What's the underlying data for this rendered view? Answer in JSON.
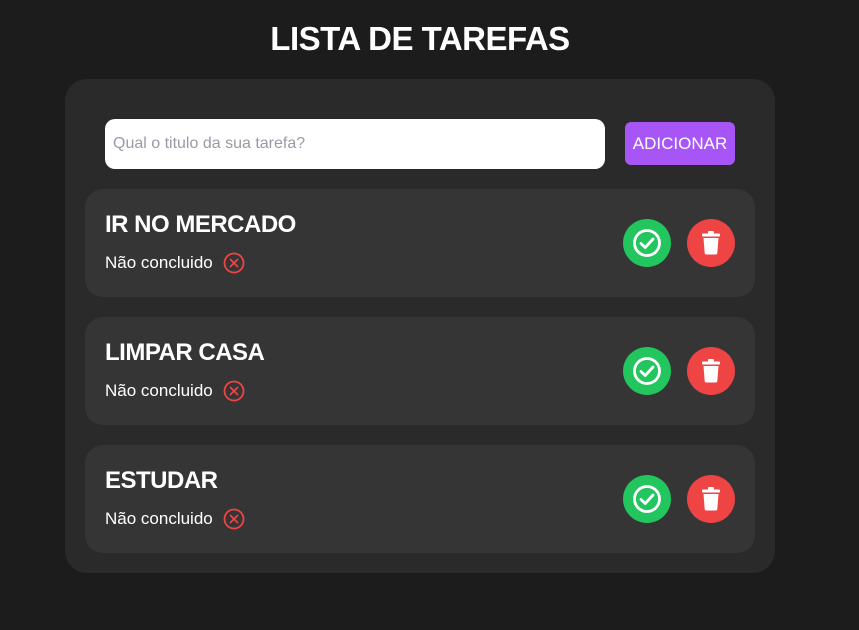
{
  "header": {
    "title": "LISTA DE TAREFAS"
  },
  "form": {
    "input_value": "",
    "placeholder": "Qual o titulo da sua tarefa?",
    "add_label": "ADICIONAR"
  },
  "tasks": [
    {
      "title": "IR NO MERCADO",
      "status": "Não concluido"
    },
    {
      "title": "LIMPAR CASA",
      "status": "Não concluido"
    },
    {
      "title": "ESTUDAR",
      "status": "Não concluido"
    }
  ],
  "icons": {
    "status": "x-circle-icon",
    "complete": "check-circle-icon",
    "delete": "trash-icon"
  },
  "colors": {
    "background": "#1c1c1d",
    "card": "#2a2a2b",
    "task": "#353536",
    "accent": "#a855f7",
    "success": "#22c55e",
    "danger": "#ef4444"
  }
}
